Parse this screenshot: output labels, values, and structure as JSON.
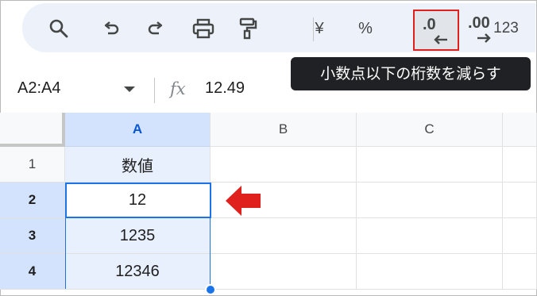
{
  "toolbar": {
    "icons": [
      "search-icon",
      "undo-icon",
      "redo-icon",
      "print-icon",
      "paint-format-icon"
    ],
    "currency_label": "¥",
    "percent_label": "%",
    "decrease_decimal_label": ".0",
    "increase_decimal_label": ".00",
    "more_formats_label": "123"
  },
  "tooltip": {
    "text": "小数点以下の桁数を減らす"
  },
  "formula_bar": {
    "name_box": "A2:A4",
    "fx_label": "fx",
    "value": "12.49"
  },
  "sheet": {
    "columns": [
      "A",
      "B",
      "C"
    ],
    "rows": [
      {
        "header": "1",
        "a": "数値"
      },
      {
        "header": "2",
        "a": "12"
      },
      {
        "header": "3",
        "a": "1235"
      },
      {
        "header": "4",
        "a": "12346"
      }
    ]
  },
  "colors": {
    "highlight_border": "#e0201c",
    "selection_blue": "#1a73e8",
    "toolbar_bg": "#edf2fa"
  }
}
